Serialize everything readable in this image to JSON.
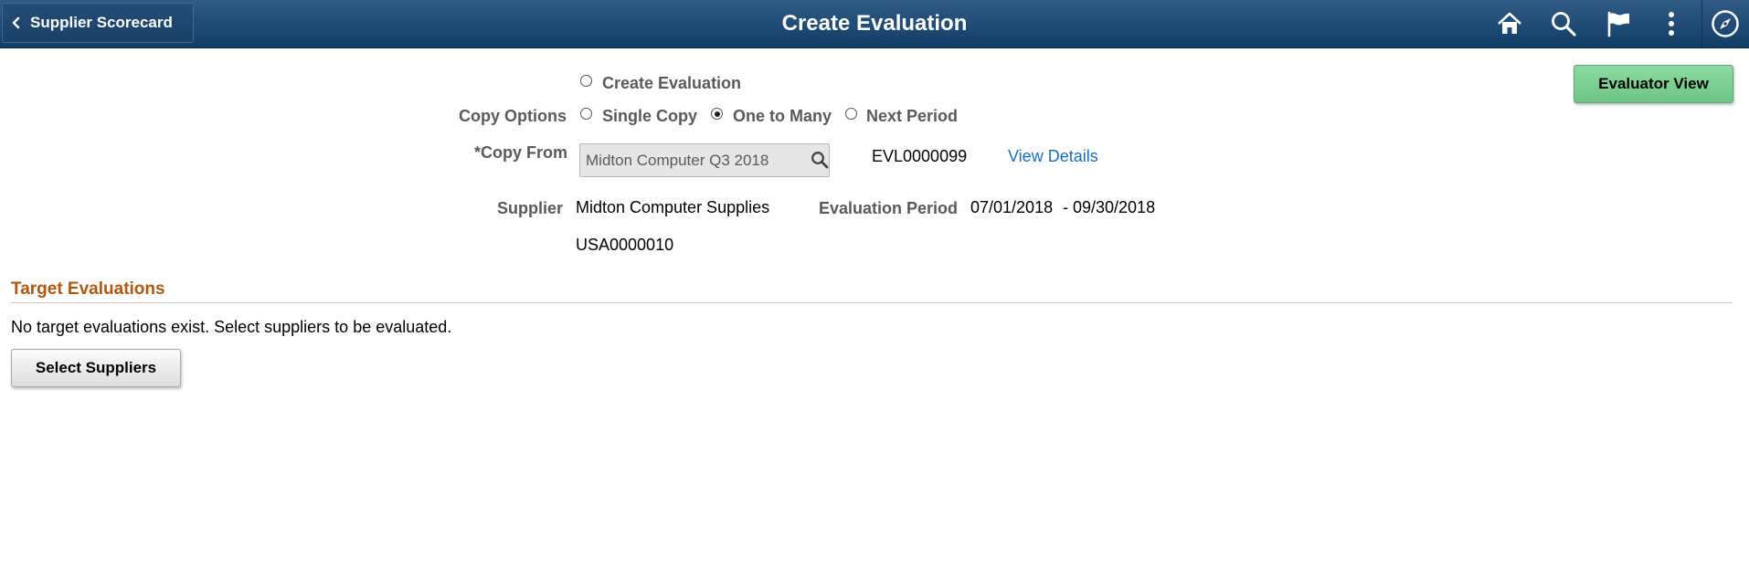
{
  "header": {
    "back_label": "Supplier Scorecard",
    "title": "Create Evaluation",
    "icons": [
      "chevron-left-icon",
      "home-icon",
      "search-icon",
      "flag-icon",
      "more-vertical-icon",
      "compass-icon"
    ]
  },
  "form": {
    "create_evaluation_label": "Create Evaluation",
    "copy_options_label": "Copy Options",
    "copy_options": {
      "single_copy": "Single Copy",
      "one_to_many": "One to Many",
      "next_period": "Next Period",
      "selected": "One to Many"
    },
    "copy_from_label": "*Copy From",
    "copy_from_value": "Midton Computer Q3 2018",
    "evaluation_id": "EVL0000099",
    "view_details_link": "View Details",
    "supplier_label": "Supplier",
    "supplier_name": "Midton Computer Supplies",
    "supplier_id": "USA0000010",
    "evaluation_period_label": "Evaluation Period",
    "period_start": "07/01/2018",
    "period_end": "- 09/30/2018"
  },
  "actions": {
    "evaluator_view": "Evaluator View",
    "select_suppliers": "Select Suppliers"
  },
  "target_evaluations": {
    "title": "Target Evaluations",
    "empty_message": "No target evaluations exist. Select suppliers to be evaluated."
  },
  "colors": {
    "banner": "#1f4a74",
    "section_title": "#b0580f",
    "link": "#1a6dc7",
    "primary_button": "#7ccf92"
  }
}
